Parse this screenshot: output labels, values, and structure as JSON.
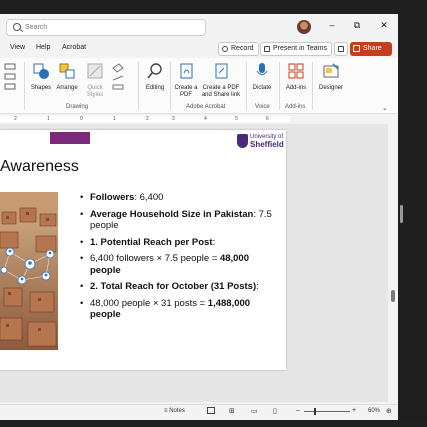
{
  "search": {
    "placeholder": "Search"
  },
  "window_controls": {
    "minimize": "–",
    "restore": "⧉",
    "close": "✕"
  },
  "menu": {
    "items": [
      "View",
      "Help",
      "Acrobat"
    ],
    "record_label": "Record",
    "present_label": "Present in Teams",
    "share_label": "Share"
  },
  "ribbon": {
    "shapes": "Shapes",
    "arrange": "Arrange",
    "quick_styles": "Quick Styles",
    "editing": "Editing",
    "create_pdf": "Create a PDF",
    "create_share": "Create a PDF and Share link",
    "dictate": "Dictate",
    "addins": "Add-ins",
    "designer": "Designer",
    "group_drawing": "Drawing",
    "group_acrobat": "Adobe Acrobat",
    "group_voice": "Voice",
    "group_addins": "Add-ins"
  },
  "ruler": [
    "2",
    "1",
    "0",
    "1",
    "2",
    "3",
    "4",
    "5",
    "6"
  ],
  "slide": {
    "title": "Awareness",
    "logo_left": "MANCHESTER 1824",
    "logo_right_line1": "University of",
    "logo_right_line2": "Sheffield",
    "bullets": [
      {
        "bold": "Followers",
        "rest": ": 6,400"
      },
      {
        "bold": "Average Household Size in Pakistan",
        "rest": ": 7.5 people"
      },
      {
        "bold": "1. Potential Reach per Post",
        "rest": ":"
      },
      {
        "bold": "",
        "rest": "6,400 followers × 7.5 people = ",
        "bold2": "48,000 people"
      },
      {
        "bold": "2. Total Reach for October (31 Posts)",
        "rest": ":"
      },
      {
        "bold": "",
        "rest": "48,000 people × 31 posts = ",
        "bold2": "1,488,000 people"
      }
    ]
  },
  "status": {
    "notes": "Notes",
    "zoom": "60%"
  },
  "colors": {
    "share": "#c43e1c",
    "sheffield": "#4b2a7b",
    "manchester": "#7a2a7a"
  }
}
